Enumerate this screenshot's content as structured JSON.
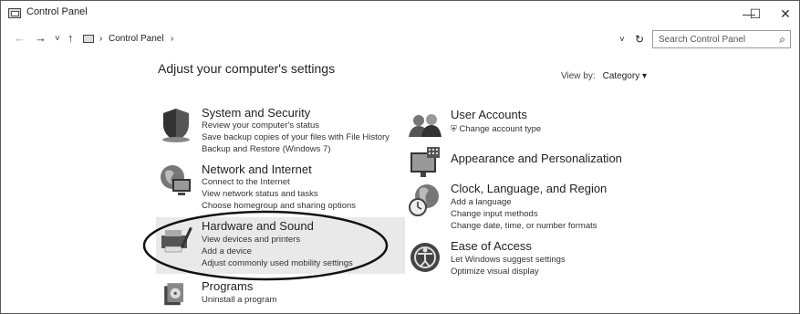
{
  "window": {
    "title": "Control Panel",
    "buttons": {
      "minimize": "—",
      "maximize": "☐",
      "close": "✕"
    }
  },
  "nav": {
    "back": "←",
    "forward": "→",
    "recent": "˅",
    "up": "↑",
    "breadcrumb": [
      "Control Panel"
    ],
    "dropdown": "˅",
    "refresh": "↻",
    "separator": "›"
  },
  "search": {
    "placeholder": "Search Control Panel",
    "icon": "⌕"
  },
  "page": {
    "title": "Adjust your computer's settings",
    "view_by_label": "View by:",
    "view_by_value": "Category ▾"
  },
  "categories": {
    "system": {
      "name": "System and Security",
      "links": [
        "Review your computer's status",
        "Save backup copies of your files with File History",
        "Backup and Restore (Windows 7)"
      ]
    },
    "network": {
      "name": "Network and Internet",
      "links": [
        "Connect to the Internet",
        "View network status and tasks",
        "Choose homegroup and sharing options"
      ]
    },
    "hardware": {
      "name": "Hardware and Sound",
      "links": [
        "View devices and printers",
        "Add a device",
        "Adjust commonly used mobility settings"
      ]
    },
    "programs": {
      "name": "Programs",
      "links": [
        "Uninstall a program"
      ]
    },
    "users": {
      "name": "User Accounts",
      "links": [
        "Change account type"
      ]
    },
    "appearance": {
      "name": "Appearance and Personalization",
      "links": []
    },
    "clock": {
      "name": "Clock, Language, and Region",
      "links": [
        "Add a language",
        "Change input methods",
        "Change date, time, or number formats"
      ]
    },
    "ease": {
      "name": "Ease of Access",
      "links": [
        "Let Windows suggest settings",
        "Optimize visual display"
      ]
    }
  },
  "colors": {
    "text": "#222222",
    "highlight": "#e9e9e9",
    "border": "#5a5a5a"
  }
}
